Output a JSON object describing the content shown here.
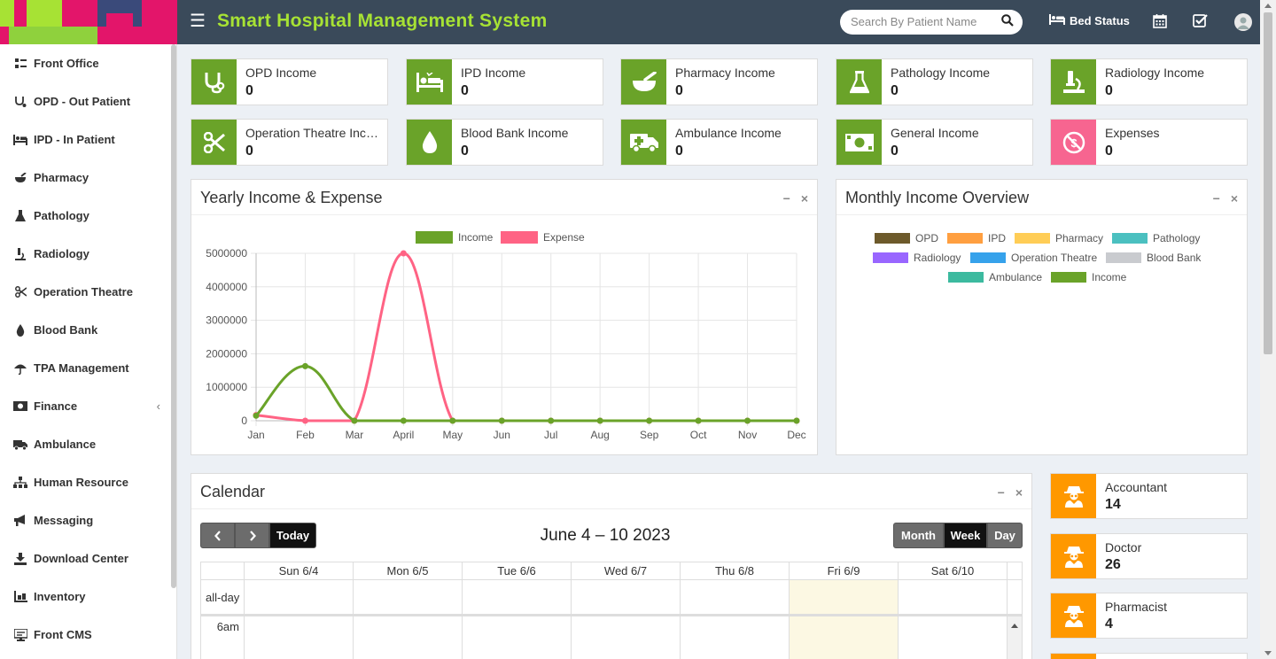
{
  "header": {
    "title": "Smart Hospital Management System",
    "search_placeholder": "Search By Patient Name",
    "bed_status": "Bed Status"
  },
  "sidebar": {
    "items": [
      {
        "label": "Front Office",
        "icon": "front-office-icon"
      },
      {
        "label": "OPD - Out Patient",
        "icon": "stethoscope-icon"
      },
      {
        "label": "IPD - In Patient",
        "icon": "bed-icon"
      },
      {
        "label": "Pharmacy",
        "icon": "mortar-icon"
      },
      {
        "label": "Pathology",
        "icon": "flask-icon"
      },
      {
        "label": "Radiology",
        "icon": "microscope-icon"
      },
      {
        "label": "Operation Theatre",
        "icon": "scissors-icon"
      },
      {
        "label": "Blood Bank",
        "icon": "drop-icon"
      },
      {
        "label": "TPA Management",
        "icon": "umbrella-icon"
      },
      {
        "label": "Finance",
        "icon": "money-icon"
      },
      {
        "label": "Ambulance",
        "icon": "ambulance-icon"
      },
      {
        "label": "Human Resource",
        "icon": "sitemap-icon"
      },
      {
        "label": "Messaging",
        "icon": "bullhorn-icon"
      },
      {
        "label": "Download Center",
        "icon": "download-icon"
      },
      {
        "label": "Inventory",
        "icon": "inventory-icon"
      },
      {
        "label": "Front CMS",
        "icon": "cms-icon"
      }
    ]
  },
  "income_boxes": [
    {
      "label": "OPD Income",
      "value": "0",
      "icon": "stethoscope-icon",
      "color": "#6aa329"
    },
    {
      "label": "IPD Income",
      "value": "0",
      "icon": "bed-icon",
      "color": "#6aa329"
    },
    {
      "label": "Pharmacy Income",
      "value": "0",
      "icon": "mortar-icon",
      "color": "#6aa329"
    },
    {
      "label": "Pathology Income",
      "value": "0",
      "icon": "flask-icon",
      "color": "#6aa329"
    },
    {
      "label": "Radiology Income",
      "value": "0",
      "icon": "microscope-icon",
      "color": "#6aa329"
    },
    {
      "label": "Operation Theatre Income",
      "value": "0",
      "icon": "scissors-icon",
      "color": "#6aa329"
    },
    {
      "label": "Blood Bank Income",
      "value": "0",
      "icon": "drop-icon",
      "color": "#6aa329"
    },
    {
      "label": "Ambulance Income",
      "value": "0",
      "icon": "ambulance-icon",
      "color": "#6aa329"
    },
    {
      "label": "General Income",
      "value": "0",
      "icon": "money-icon",
      "color": "#6aa329"
    },
    {
      "label": "Expenses",
      "value": "0",
      "icon": "ban-dollar-icon",
      "color": "#f76590"
    }
  ],
  "yearly_panel": {
    "title": "Yearly Income & Expense"
  },
  "monthly_panel": {
    "title": "Monthly Income Overview",
    "legend": [
      {
        "label": "OPD",
        "color": "#6d5a2b"
      },
      {
        "label": "IPD",
        "color": "#ff9f40"
      },
      {
        "label": "Pharmacy",
        "color": "#ffcd56"
      },
      {
        "label": "Pathology",
        "color": "#4bc0c0"
      },
      {
        "label": "Radiology",
        "color": "#9966ff"
      },
      {
        "label": "Operation Theatre",
        "color": "#36a2eb"
      },
      {
        "label": "Blood Bank",
        "color": "#c9cbcf"
      },
      {
        "label": "Ambulance",
        "color": "#3cba9f"
      },
      {
        "label": "Income",
        "color": "#6aa329"
      }
    ]
  },
  "chart_data": {
    "type": "line",
    "categories": [
      "Jan",
      "Feb",
      "Mar",
      "April",
      "May",
      "Jun",
      "Jul",
      "Aug",
      "Sep",
      "Oct",
      "Nov",
      "Dec"
    ],
    "series": [
      {
        "name": "Income",
        "color": "#6aa329",
        "values": [
          150000,
          1630000,
          0,
          0,
          0,
          0,
          0,
          0,
          0,
          0,
          0,
          0
        ]
      },
      {
        "name": "Expense",
        "color": "#ff6384",
        "values": [
          170000,
          0,
          0,
          5000000,
          0,
          0,
          0,
          0,
          0,
          0,
          0,
          0
        ]
      }
    ],
    "yticks": [
      "0",
      "1000000",
      "2000000",
      "3000000",
      "4000000",
      "5000000"
    ],
    "ylim": [
      0,
      5000000
    ],
    "grid": true,
    "legend_position": "top"
  },
  "calendar": {
    "title": "Calendar",
    "range": "June 4 – 10 2023",
    "today_label": "Today",
    "views": [
      "Month",
      "Week",
      "Day"
    ],
    "active_view": "Week",
    "days": [
      "Sun 6/4",
      "Mon 6/5",
      "Tue 6/6",
      "Wed 6/7",
      "Thu 6/8",
      "Fri 6/9",
      "Sat 6/10"
    ],
    "highlight_day": "Fri 6/9",
    "allday_label": "all-day",
    "first_hour": "6am"
  },
  "staff": [
    {
      "label": "Accountant",
      "value": "14",
      "icon": "user-secret-icon"
    },
    {
      "label": "Doctor",
      "value": "26",
      "icon": "user-secret-icon"
    },
    {
      "label": "Pharmacist",
      "value": "4",
      "icon": "user-secret-icon"
    }
  ]
}
